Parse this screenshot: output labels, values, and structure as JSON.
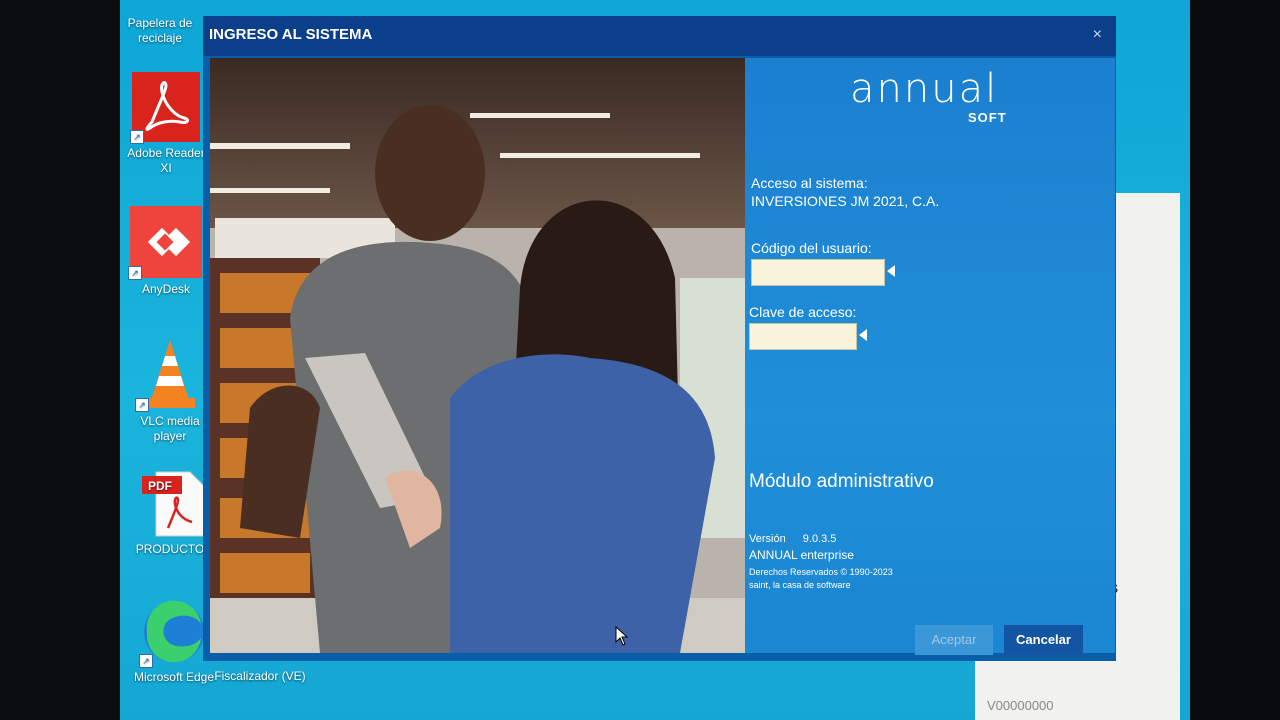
{
  "desktop": {
    "icons": [
      {
        "label": "Papelera de reciclaje",
        "icon": "recycle-bin-icon"
      },
      {
        "label": "Adobe Reader XI",
        "icon": "adobe-reader-icon"
      },
      {
        "label": "AnyDesk",
        "icon": "anydesk-icon"
      },
      {
        "label": "VLC media player",
        "icon": "vlc-icon"
      },
      {
        "label": "PRODUCTOS",
        "icon": "pdf-file-icon"
      },
      {
        "label": "Microsoft Edge",
        "icon": "edge-icon"
      },
      {
        "label": "Fiscalizador (VE)",
        "icon": "fiscalizador-icon"
      }
    ]
  },
  "background_window": {
    "fragment_text": "AS",
    "code": "V00000000"
  },
  "dialog": {
    "title": "INGRESO AL SISTEMA",
    "close_label": "×",
    "logo": {
      "main": "annual",
      "sub": "SOFT"
    },
    "access_label": "Acceso al sistema:",
    "company": "INVERSIONES JM 2021, C.A.",
    "user_code_label": "Código del usuario:",
    "user_code_value": "",
    "password_label": "Clave de acceso:",
    "password_value": "",
    "module": "Módulo administrativo",
    "version_label": "Versión",
    "version_value": "9.0.3.5",
    "product": "ANNUAL enterprise",
    "copyright": "Derechos Reservados © 1990-2023",
    "vendor": "saint, la casa de software",
    "accept_label": "Aceptar",
    "cancel_label": "Cancelar"
  }
}
